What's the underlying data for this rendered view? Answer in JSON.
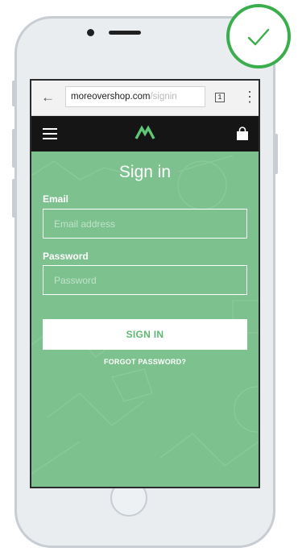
{
  "browser": {
    "back_icon": "arrow-left-icon",
    "url_domain": "moreovershop.com",
    "url_path": "/signin",
    "tab_count": "1",
    "menu_icon": "vertical-dots-icon"
  },
  "navbar": {
    "menu_icon": "hamburger-icon",
    "logo_icon": "m-logo-icon",
    "cart_icon": "shopping-bag-icon"
  },
  "signin": {
    "title": "Sign in",
    "email_label": "Email",
    "email_placeholder": "Email address",
    "email_value": "",
    "password_label": "Password",
    "password_placeholder": "Password",
    "password_value": "",
    "submit_label": "SIGN IN",
    "forgot_label": "FORGOT PASSWORD?"
  },
  "badge": {
    "icon": "checkmark-icon"
  },
  "colors": {
    "brand_green": "#7dc18f",
    "button_text_green": "#5fb774",
    "badge_green": "#3aad4c",
    "navbar_black": "#151515"
  }
}
